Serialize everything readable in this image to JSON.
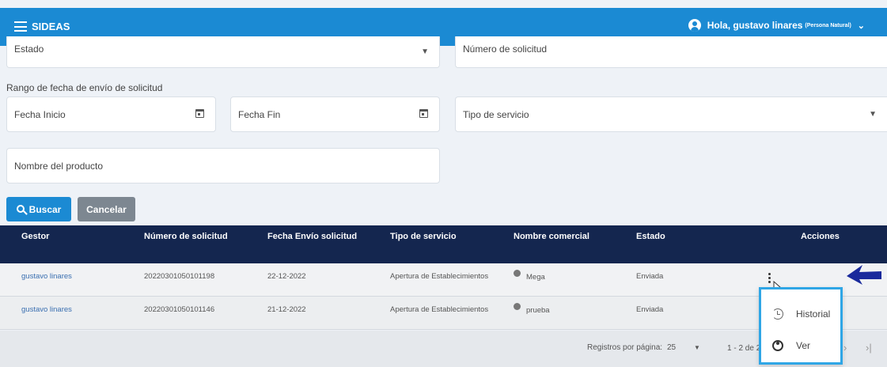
{
  "topbar": {
    "brand": "SIDEAS",
    "greeting": "Hola, gustavo linares",
    "user_type": "(Persona Natural)"
  },
  "filters": {
    "estado": "Estado",
    "numero_solicitud": "Número de solicitud",
    "range_label": "Rango de fecha de envío de solicitud",
    "fecha_inicio": "Fecha Inicio",
    "fecha_fin": "Fecha Fin",
    "tipo_servicio": "Tipo de servicio",
    "nombre_producto": "Nombre del producto"
  },
  "buttons": {
    "search": "Buscar",
    "cancel": "Cancelar"
  },
  "table": {
    "headers": [
      "Gestor",
      "Número de solicitud",
      "Fecha Envío solicitud",
      "Tipo de servicio",
      "Nombre comercial",
      "Estado",
      "Acciones"
    ],
    "rows": [
      {
        "gestor": "gustavo linares",
        "numero": "20220301050101198",
        "fecha": "22-12-2022",
        "tipo": "Apertura de Establecimientos",
        "nombre": "Mega",
        "estado": "Enviada"
      },
      {
        "gestor": "gustavo linares",
        "numero": "20220301050101146",
        "fecha": "21-12-2022",
        "tipo": "Apertura de Establecimientos",
        "nombre": "prueba",
        "estado": "Enviada"
      }
    ]
  },
  "pagination": {
    "rows_per_page_label": "Registros por página:",
    "rows_per_page_value": "25",
    "range": "1 - 2 de 2"
  },
  "actions_menu": {
    "historial": "Historial",
    "ver": "Ver"
  },
  "colors": {
    "topbar": "#1b8ad3",
    "table_header": "#14264f",
    "menu_highlight": "#2fa6e6",
    "annotation_arrow": "#1a2a9c"
  }
}
